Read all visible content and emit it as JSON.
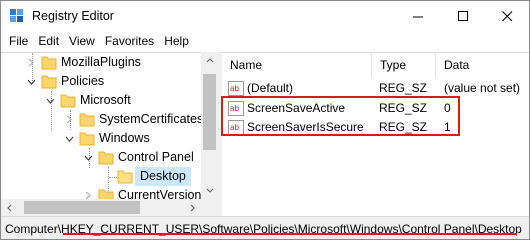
{
  "window": {
    "title": "Registry Editor",
    "controls": {
      "minimize": "—",
      "maximize": "☐",
      "close": "✕"
    }
  },
  "menu": {
    "items": [
      {
        "label": "File"
      },
      {
        "label": "Edit"
      },
      {
        "label": "View"
      },
      {
        "label": "Favorites"
      },
      {
        "label": "Help"
      }
    ]
  },
  "tree": {
    "nodes": [
      {
        "label": "MozillaPlugins",
        "expanded": false
      },
      {
        "label": "Policies",
        "expanded": true
      },
      {
        "label": "Microsoft",
        "expanded": true
      },
      {
        "label": "SystemCertificates",
        "expanded": false
      },
      {
        "label": "Windows",
        "expanded": true
      },
      {
        "label": "Control Panel",
        "expanded": true
      },
      {
        "label": "Desktop",
        "selected": true
      },
      {
        "label": "CurrentVersion",
        "expanded": false
      }
    ]
  },
  "list": {
    "columns": [
      {
        "label": "Name"
      },
      {
        "label": "Type"
      },
      {
        "label": "Data"
      }
    ],
    "rows": [
      {
        "name": "(Default)",
        "type": "REG_SZ",
        "data": "(value not set)"
      },
      {
        "name": "ScreenSaveActive",
        "type": "REG_SZ",
        "data": "0"
      },
      {
        "name": "ScreenSaverIsSecure",
        "type": "REG_SZ",
        "data": "1"
      }
    ]
  },
  "status": {
    "path": "Computer\\HKEY_CURRENT_USER\\Software\\Policies\\Microsoft\\Windows\\Control Panel\\Desktop"
  },
  "colors": {
    "highlight": "#d81c1c",
    "selection": "#cce8ff",
    "folder": "#ffd66b",
    "folder_dark": "#e6b33c"
  }
}
